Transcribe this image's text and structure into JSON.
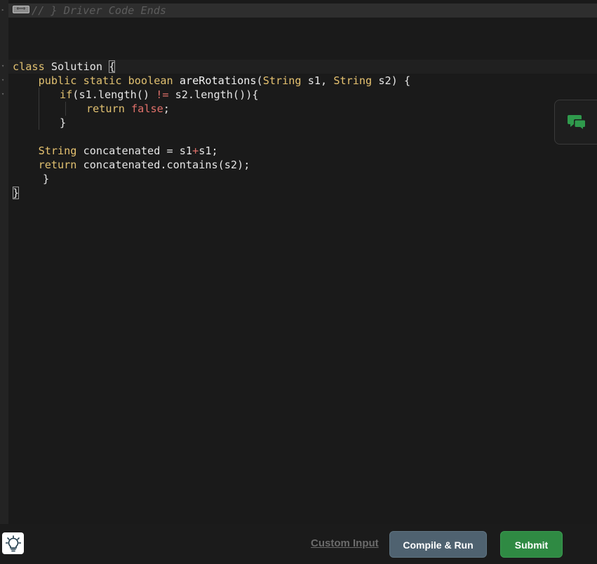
{
  "editor": {
    "folded_comment": "// } Driver Code Ends",
    "fold_badge": "⟺",
    "code": {
      "class_kw": "class",
      "class_name": "Solution",
      "open_brace": "{",
      "public_kw": "public",
      "static_kw": "static",
      "boolean_kw": "boolean",
      "method_name": "areRotations",
      "lparen": "(",
      "string_type": "String",
      "param_s1": "s1,",
      "param_s2": "s2)",
      "method_open": "{",
      "if_kw": "if",
      "if_cond_start": "(s1.length()",
      "neq_op": "!=",
      "if_cond_end": "s2.length()){",
      "return_kw": "return",
      "false_kw": "false",
      "semicolon": ";",
      "if_close": "}",
      "concat_type": "String",
      "concat_decl": "concatenated =",
      "concat_s1": "s1",
      "plus_op": "+",
      "concat_s1b": "s1;",
      "return_kw2": "return",
      "return_expr": "concatenated.contains(s2);",
      "method_close": "}",
      "class_close": "}"
    }
  },
  "footer": {
    "custom_input_label": "Custom Input",
    "compile_run_label": "Compile & Run",
    "submit_label": "Submit"
  },
  "colors": {
    "run_button": "#4f6270",
    "submit_button": "#2f8a43",
    "chat_icon": "#2f9a4c"
  },
  "icons": {
    "chat": "chat-bubbles-icon",
    "hint": "lightbulb-icon"
  }
}
